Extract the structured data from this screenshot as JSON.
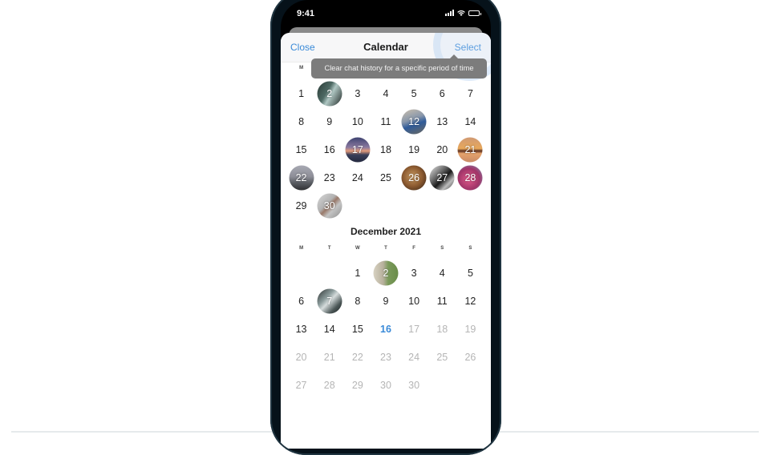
{
  "status_bar": {
    "time": "9:41",
    "icons": [
      "cellular-signal-icon",
      "wifi-icon",
      "battery-icon"
    ]
  },
  "nav": {
    "close_label": "Close",
    "title": "Calendar",
    "select_label": "Select"
  },
  "tooltip": {
    "text": "Clear chat history for a specific period of time"
  },
  "accent_color": "#3a8ad8",
  "months": [
    {
      "title": "",
      "weekdays": [
        "M",
        "",
        "",
        "",
        "",
        "",
        ""
      ],
      "offset": 0,
      "days": [
        {
          "n": "1"
        },
        {
          "n": "2",
          "photo": "linear-gradient(120deg,#2a3a36 0%,#4e6a64 40%,#b0c8c4 55%,#1e2624 100%)"
        },
        {
          "n": "3"
        },
        {
          "n": "4"
        },
        {
          "n": "5"
        },
        {
          "n": "6"
        },
        {
          "n": "7"
        },
        {
          "n": "8"
        },
        {
          "n": "9"
        },
        {
          "n": "10"
        },
        {
          "n": "11"
        },
        {
          "n": "12",
          "photo": "linear-gradient(160deg,#cbbfae 0%,#8a98ab 40%,#2f5b9a 60%,#6f6a5e 100%)"
        },
        {
          "n": "13"
        },
        {
          "n": "14"
        },
        {
          "n": "15"
        },
        {
          "n": "16"
        },
        {
          "n": "17",
          "photo": "linear-gradient(180deg,#3e4270 0%,#8b7aa0 40%,#e39a7a 55%,#3a3f5a 70%,#23283e 100%)"
        },
        {
          "n": "18"
        },
        {
          "n": "19"
        },
        {
          "n": "20"
        },
        {
          "n": "21",
          "photo": "linear-gradient(180deg,#d09a74 0%,#e8a85a 45%,#5a2e20 55%,#e6a36c 65%,#c98a66 100%)"
        },
        {
          "n": "22",
          "photo": "linear-gradient(180deg,#a8a9b3 0%,#8e8f98 45%,#5a5d63 70%,#2f3033 100%)"
        },
        {
          "n": "23"
        },
        {
          "n": "24"
        },
        {
          "n": "25"
        },
        {
          "n": "26",
          "photo": "radial-gradient(circle at 45% 45%,#c89a62 0%,#8c5a30 50%,#2c1e14 100%)"
        },
        {
          "n": "27",
          "photo": "linear-gradient(135deg,#ececec 0%,#6c6c6c 35%,#1a1a1a 55%,#bcbcbc 75%,#3a3a3a 100%)"
        },
        {
          "n": "28",
          "photo": "radial-gradient(circle at 45% 55%,#e25a8c 0%,#a03468 55%,#7fa0c0 100%)"
        },
        {
          "n": "29"
        },
        {
          "n": "30",
          "photo": "linear-gradient(135deg,#d8d8d8 0%,#b2b2b2 40%,#9a7a6a 50%,#c4c4c4 65%,#8c8c8c 100%)"
        }
      ]
    },
    {
      "title": "December 2021",
      "weekdays": [
        "M",
        "T",
        "W",
        "T",
        "F",
        "S",
        "S"
      ],
      "offset": 2,
      "days": [
        {
          "n": "1"
        },
        {
          "n": "2",
          "photo": "linear-gradient(90deg,#d8d2c2 0%,#b7b09c 40%,#7a9a5a 60%,#6a8c4a 100%)"
        },
        {
          "n": "3"
        },
        {
          "n": "4"
        },
        {
          "n": "5"
        },
        {
          "n": "6"
        },
        {
          "n": "7",
          "photo": "linear-gradient(135deg,#2a2e2e 0%,#8a9a9a 35%,#d6dcdc 50%,#4a5656 75%,#1e2222 100%)"
        },
        {
          "n": "8"
        },
        {
          "n": "9"
        },
        {
          "n": "10"
        },
        {
          "n": "11"
        },
        {
          "n": "12"
        },
        {
          "n": "13"
        },
        {
          "n": "14"
        },
        {
          "n": "15"
        },
        {
          "n": "16",
          "today": true
        },
        {
          "n": "17",
          "future": true
        },
        {
          "n": "18",
          "future": true
        },
        {
          "n": "19",
          "future": true
        },
        {
          "n": "20",
          "future": true
        },
        {
          "n": "21",
          "future": true
        },
        {
          "n": "22",
          "future": true
        },
        {
          "n": "23",
          "future": true
        },
        {
          "n": "24",
          "future": true
        },
        {
          "n": "25",
          "future": true
        },
        {
          "n": "26",
          "future": true
        },
        {
          "n": "27",
          "future": true
        },
        {
          "n": "28",
          "future": true
        },
        {
          "n": "29",
          "future": true
        },
        {
          "n": "30",
          "future": true
        },
        {
          "n": "30",
          "future": true
        }
      ]
    }
  ]
}
